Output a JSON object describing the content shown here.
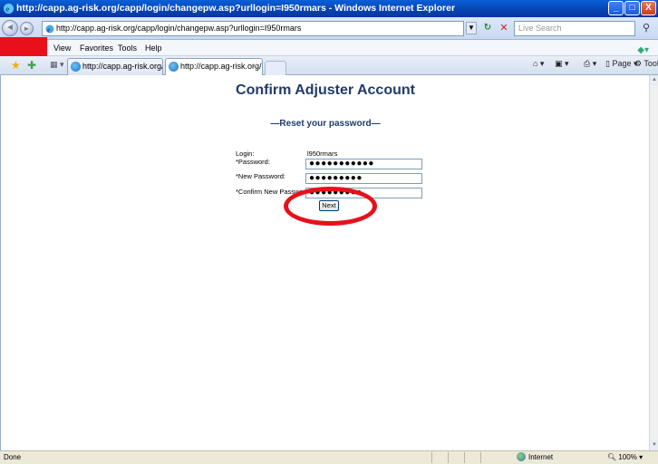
{
  "window": {
    "title": "http://capp.ag-risk.org/capp/login/changepw.asp?urllogin=I950rmars - Windows Internet Explorer",
    "minimize": "_",
    "maximize": "□",
    "close": "X"
  },
  "toolbar": {
    "address": "http://capp.ag-risk.org/capp/login/changepw.asp?urllogin=I950rmars",
    "search_placeholder": "Live Search"
  },
  "menu": {
    "items": [
      "View",
      "Favorites",
      "Tools",
      "Help"
    ]
  },
  "tabs": [
    {
      "label": "http://capp.ag-risk.org/capp/"
    },
    {
      "label": "http://capp.ag-risk.org/c...",
      "close": "✕"
    }
  ],
  "commands": {
    "page": "Page",
    "tools": "Tools"
  },
  "page": {
    "title": "Confirm Adjuster Account",
    "subtitle": "—Reset your password—",
    "form": {
      "login_label": "Login:",
      "login_value": "l950rmars",
      "password_label": "*Password:",
      "password_value": "●●●●●●●●●●●",
      "new_password_label": "*New Password:",
      "new_password_value": "●●●●●●●●●",
      "confirm_password_label": "*Confirm New Password:",
      "confirm_password_value": "●●●●●●●●●",
      "next_label": "Next"
    }
  },
  "status": {
    "text": "Done",
    "zone": "Internet",
    "zoom": "100%"
  },
  "colors": {
    "title_blue": "#1F3B6B",
    "highlight_red": "#E8101A"
  }
}
